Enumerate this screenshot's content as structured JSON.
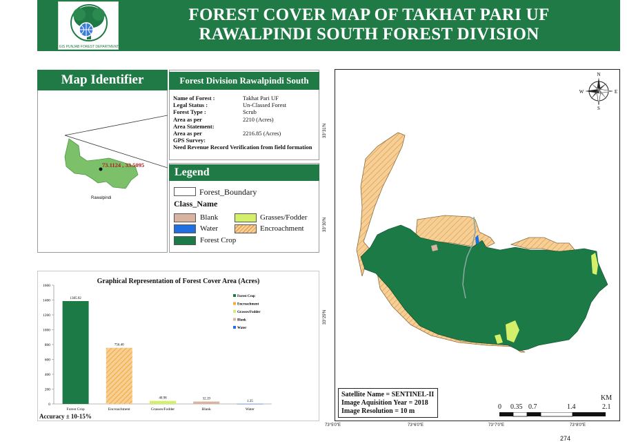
{
  "header": {
    "title_line1": "FOREST COVER MAP OF TAKHAT PARI UF",
    "title_line2": "RAWALPINDI SOUTH FOREST DIVISION",
    "logo_text": "GIS PUNJAB FOREST DEPARTMENT"
  },
  "map_identifier": {
    "heading": "Map Identifier",
    "coordinates": "73.1124 , 33.5095",
    "district_label": "Rawalpindi"
  },
  "forest_division": {
    "heading": "Forest Division Rawalpindi South",
    "rows": [
      {
        "label": "Name of Forest :",
        "value": "Takhat Pari UF"
      },
      {
        "label": "Legal Status :",
        "value": "Un-Classed Forest"
      },
      {
        "label": "Forest Type :",
        "value": "Scrub"
      },
      {
        "label": "Area as per",
        "value": "2210 (Acres)"
      },
      {
        "label": "Area Statement:",
        "value": ""
      },
      {
        "label": "Area as per",
        "value": "2216.85 (Acres)"
      },
      {
        "label": "GPS Survey:",
        "value": ""
      }
    ],
    "note": "Need Revenue Record Verification from field formation"
  },
  "legend": {
    "heading": "Legend",
    "boundary_label": "Forest_Boundary",
    "class_title": "Class_Name",
    "items": [
      {
        "label": "Blank",
        "color": "#d8b4a0"
      },
      {
        "label": "Grasses/Fodder",
        "color": "#d4f06a"
      },
      {
        "label": "Water",
        "color": "#1f6fe0"
      },
      {
        "label": "Encroachment",
        "color": "#f6cf95"
      },
      {
        "label": "Forest Crop",
        "color": "#1b7a45"
      }
    ]
  },
  "chart_data": {
    "type": "bar",
    "title": "Graphical Representation of Forest Cover Area (Acres)",
    "categories": [
      "Forest Crop",
      "Encroachment",
      "Grasses/Fodder",
      "Blank",
      "Water"
    ],
    "values": [
      1385.92,
      756.4,
      40.98,
      32.19,
      1.35
    ],
    "value_labels": [
      "1385.92",
      "756.40",
      "40.98",
      "32.19",
      "1.35"
    ],
    "colors": [
      "#1b7a45",
      "#f6a93a",
      "#d4f06a",
      "#d8b4a0",
      "#1f6fe0"
    ],
    "yticks": [
      0,
      200,
      400,
      600,
      800,
      1000,
      1200,
      1400,
      1600
    ],
    "ylim": [
      0,
      1600
    ],
    "legend": [
      "Forest Crop",
      "Encroachment",
      "Grasses/Fodder",
      "Blank",
      "Water"
    ],
    "legend_placement": "top-right",
    "accuracy": "Accuracy ± 10-15%"
  },
  "main_map": {
    "north_letters": {
      "n": "N",
      "s": "S",
      "e": "E",
      "w": "W"
    },
    "lat_labels": [
      "33°31'N",
      "33°30'N",
      "33°29'N"
    ],
    "lon_labels": [
      "73°5'0\"E",
      "73°6'0\"E",
      "73°7'0\"E",
      "73°8'0\"E"
    ],
    "satellite_info": [
      "Satellite Name = SENTINEL-II",
      "Image Aquisition Year = 2018",
      "Image Resolution = 10 m"
    ],
    "scale": {
      "unit": "KM",
      "labels": [
        "0",
        "0.35",
        "0.7",
        "1.4",
        "2.1"
      ]
    }
  },
  "page_number": "274"
}
